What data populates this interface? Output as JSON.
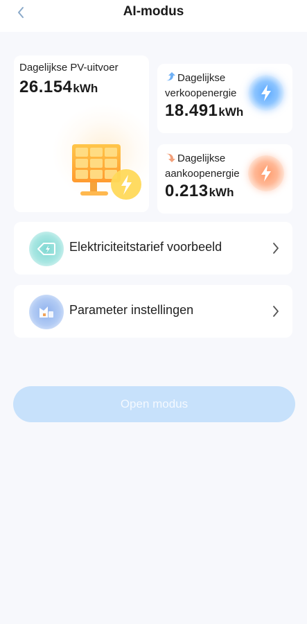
{
  "header": {
    "title": "AI-modus",
    "back_icon": "chevron-left-icon"
  },
  "pv": {
    "label": "Dagelijkse PV-uitvoer",
    "value": "26.154",
    "unit": "kWh",
    "icon": "solar-panel-icon"
  },
  "sell": {
    "label": "Dagelijkse verkoopenergie",
    "value": "18.491",
    "unit": "kWh",
    "arrow_icon": "arrow-up-icon",
    "badge_icon": "lightning-icon",
    "accent": "#5aa9ff"
  },
  "buy": {
    "label": "Dagelijkse aankoopenergie",
    "value": "0.213",
    "unit": "kWh",
    "arrow_icon": "arrow-down-icon",
    "badge_icon": "lightning-icon",
    "accent": "#ff9a6a"
  },
  "menu": {
    "items": [
      {
        "label": "Elektriciteitstarief voorbeeld",
        "icon": "price-tag-icon"
      },
      {
        "label": "Parameter instellingen",
        "icon": "settings-chart-icon"
      }
    ]
  },
  "actions": {
    "open_label": "Open modus"
  }
}
